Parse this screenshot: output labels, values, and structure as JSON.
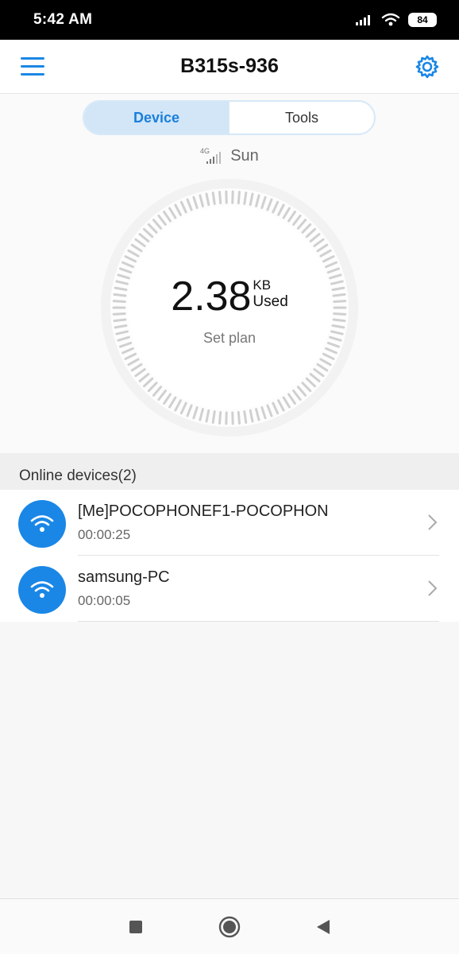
{
  "status_bar": {
    "time": "5:42 AM",
    "battery": "84",
    "icons": [
      "signal-icon",
      "wifi-icon",
      "battery-icon"
    ]
  },
  "app_bar": {
    "title": "B315s-936",
    "menu_icon": "menu-icon",
    "settings_icon": "gear-icon"
  },
  "tabs": [
    {
      "label": "Device",
      "active": true
    },
    {
      "label": "Tools",
      "active": false
    }
  ],
  "network": {
    "type": "4G",
    "operator": "Sun",
    "signal_bars": 4
  },
  "usage": {
    "value": "2.38",
    "unit": "KB",
    "label": "Used",
    "action": "Set plan"
  },
  "online_devices": {
    "header": "Online devices(2)",
    "items": [
      {
        "name": "[Me]POCOPHONEF1-POCOPHON",
        "duration": "00:00:25",
        "icon": "wifi-icon"
      },
      {
        "name": "samsung-PC",
        "duration": "00:00:05",
        "icon": "wifi-icon"
      }
    ]
  },
  "nav_bar": {
    "buttons": [
      "recents-button",
      "home-button",
      "back-button"
    ]
  },
  "colors": {
    "accent": "#1a87e6",
    "tab_active_bg": "#d2e6f8",
    "status_bar_bg": "#000000"
  }
}
